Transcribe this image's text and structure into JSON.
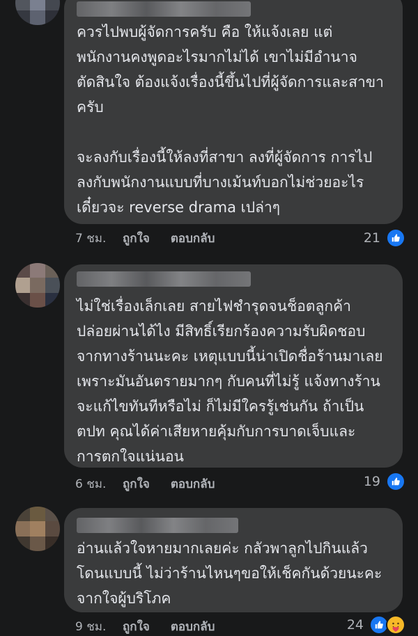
{
  "comments": [
    {
      "text": "ควรไปพบผู้จัดการครับ คือ ให้แจ้งเลย แต่\nพนักงานคงพูดอะไรมากไม่ได้ เขาไม่มีอำนาจ\nตัดสินใจ ต้องแจ้งเรื่องนี้ขึ้นไปที่ผู้จัดการและสาขา\nครับ\n\nจะลงกับเรื่องนี้ให้ลงที่สาขา ลงที่ผู้จัดการ การไป\nลงกับพนักงานแบบที่บางเม้นท์บอกไม่ช่วยอะไร\nเดี๋ยวจะ reverse drama เปล่าๆ",
      "time": "7 ชม.",
      "like_label": "ถูกใจ",
      "reply_label": "ตอบกลับ",
      "reaction_count": "21",
      "reactions": [
        "like-icon"
      ]
    },
    {
      "text": "ไม่ใช่เรื่องเล็กเลย สายไฟชำรุดจนช็อตลูกค้า\nปล่อยผ่านได้ไง มีสิทธิ์เรียกร้องความรับผิดชอบ\nจากทางร้านนะคะ เหตุแบบนี้น่าเปิดชื่อร้านมาเลย\nเพราะมันอันตรายมากๆ กับคนที่ไม่รู้ แจ้งทางร้าน\nจะแก้ไขทันทีหรือไม่ ก็ไม่มีใครรู้เช่นกัน ถ้าเป็น\nตปท คุณได้ค่าเสียหายคุ้มกับการบาดเจ็บและ\nการตกใจแน่นอน",
      "time": "6 ชม.",
      "like_label": "ถูกใจ",
      "reply_label": "ตอบกลับ",
      "reaction_count": "19",
      "reactions": [
        "like-icon"
      ]
    },
    {
      "text": "อ่านแล้วใจหายมากเลยค่ะ กลัวพาลูกไปกินแล้ว\nโดนแบบนี้ ไม่ว่าร้านไหนๆขอให้เช็คกันด้วยนะคะ\nจากใจผู้บริโภค",
      "time": "9 ชม.",
      "like_label": "ถูกใจ",
      "reply_label": "ตอบกลับ",
      "reaction_count": "24",
      "reactions": [
        "like-icon",
        "care-icon"
      ]
    }
  ],
  "colors": {
    "background": "#18191a",
    "bubble": "#3a3b3c",
    "text": "#e4e6eb",
    "meta": "#b0b3b8",
    "like_blue": "#1877f2",
    "care_yellow": "#f7b928"
  }
}
